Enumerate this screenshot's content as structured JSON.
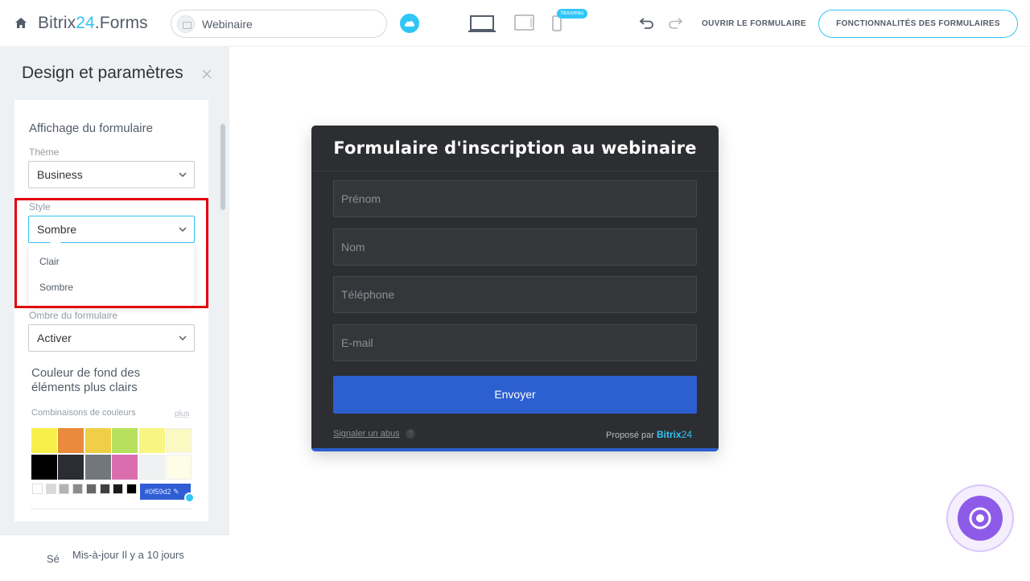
{
  "header": {
    "brand_main": "Bitrix",
    "brand_accent": "24",
    "brand_suffix": ".Forms",
    "form_name": "Webinaire",
    "new_badge": "Nouveau",
    "open_form": "OUVRIR LE FORMULAIRE",
    "features": "FONCTIONNALITÉS DES FORMULAIRES"
  },
  "panel": {
    "title": "Design et paramètres",
    "section_title": "Affichage du formulaire",
    "theme": {
      "label": "Thème",
      "value": "Business"
    },
    "style": {
      "label": "Style",
      "value": "Sombre",
      "options": [
        "Clair",
        "Sombre"
      ]
    },
    "shadow": {
      "label": "Ombre du formulaire",
      "value": "Activer"
    },
    "color_title": "Couleur de fond des éléments plus clairs",
    "combos_label": "Combinaisons de couleurs",
    "more_link": "plus",
    "swatch_colors": [
      "#f7f04a",
      "#e98b3a",
      "#f0cf47",
      "#b7e15c",
      "#f8f582",
      "#fbf9c2",
      "#000000",
      "#2a2d33",
      "#72777d",
      "#d96dae",
      "#f0f1f2",
      "#fdfde8"
    ],
    "gray_colors": [
      "#ffffff",
      "#d9d9d9",
      "#b3b3b3",
      "#8c8c8c",
      "#666666",
      "#404040",
      "#1a1a1a",
      "#000000"
    ],
    "hex_value": "#0f59d2",
    "footer_short": "Sé",
    "footer_update": "Mis-à-jour Il y a 10 jours"
  },
  "form": {
    "title": "Formulaire d'inscription au webinaire",
    "fields": [
      "Prénom",
      "Nom",
      "Téléphone",
      "E-mail"
    ],
    "submit": "Envoyer",
    "abuse": "Signaler un abus",
    "help": "?",
    "powered_prefix": "Proposé par",
    "powered_brand": "Bitrix",
    "powered_num": "24"
  }
}
